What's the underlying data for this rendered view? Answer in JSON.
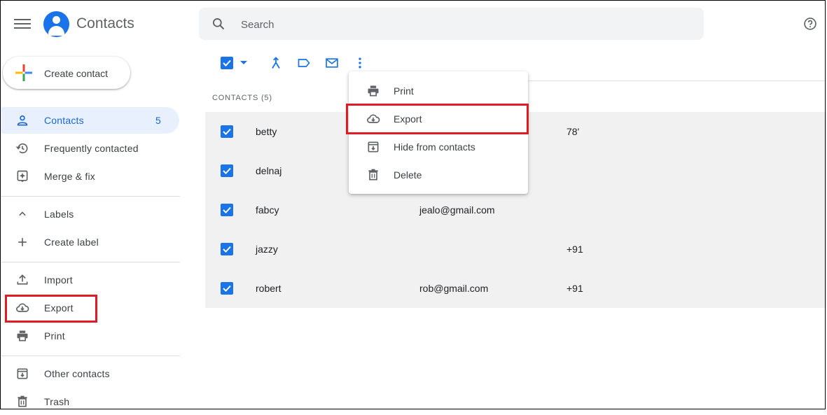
{
  "header": {
    "app_title": "Contacts",
    "search_placeholder": "Search"
  },
  "sidebar": {
    "create_label": "Create contact",
    "contacts_label": "Contacts",
    "contacts_count": "5",
    "frequent_label": "Frequently contacted",
    "merge_label": "Merge & fix",
    "labels_label": "Labels",
    "create_label_label": "Create label",
    "import_label": "Import",
    "export_label": "Export",
    "print_label": "Print",
    "other_contacts_label": "Other contacts",
    "trash_label": "Trash"
  },
  "list": {
    "header": "CONTACTS (5)",
    "rows": [
      {
        "name": "betty",
        "email": "",
        "phone": "78'"
      },
      {
        "name": "delnaj",
        "email": "",
        "phone": ""
      },
      {
        "name": "fabcy",
        "email": "jealo@gmail.com",
        "phone": ""
      },
      {
        "name": "jazzy",
        "email": "",
        "phone": "+91"
      },
      {
        "name": "robert",
        "email": "rob@gmail.com",
        "phone": "+91"
      }
    ]
  },
  "menu": {
    "print": "Print",
    "export": "Export",
    "hide": "Hide from contacts",
    "delete": "Delete"
  },
  "colors": {
    "accent": "#1a73e8",
    "highlight_box": "#e01b24",
    "row_bg": "#f1f1f1"
  }
}
